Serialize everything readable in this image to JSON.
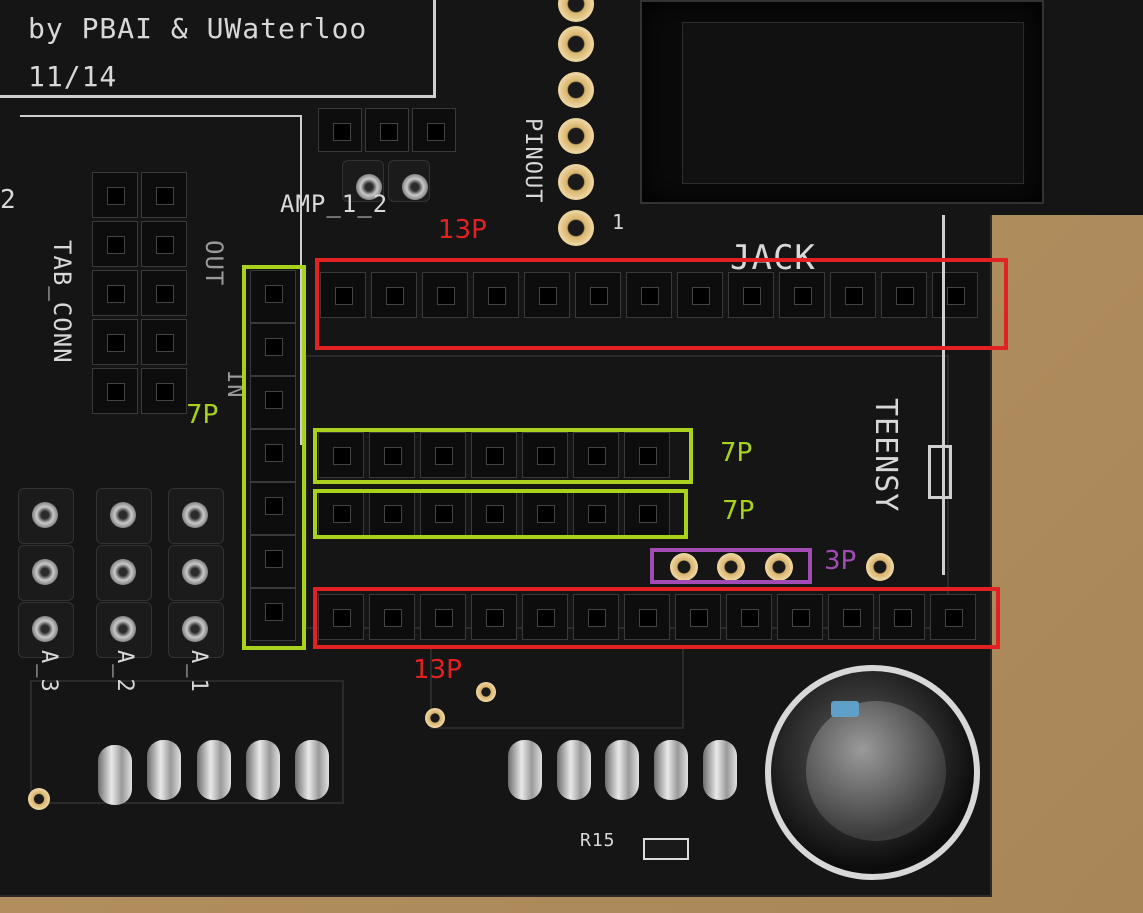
{
  "photo": {
    "board_silkscreen": {
      "credit": "by PBAI & UWaterloo",
      "date": "11/14",
      "amp_label": "AMP_1_2",
      "pinout_label": "PINOUT",
      "jack_label": "JACK",
      "teensy_label": "TEENSY",
      "tab_conn_label": "TAB_CONN",
      "out_label": "OUT",
      "in_label": "IN",
      "a3_label": "A_3",
      "a2_label": "A_2",
      "a1_label": "A_1",
      "r15_label": "R15",
      "pin1_label": "1",
      "num2_label": "2"
    },
    "annotations": {
      "top_13p": "13P",
      "bottom_13p": "13P",
      "vertical_7p": "7P",
      "row1_7p": "7P",
      "row2_7p": "7P",
      "pads_3p": "3P"
    },
    "colors": {
      "red_box": "#e22222",
      "green_box": "#a8d21e",
      "purple_box": "#a34bb5",
      "pcb": "#151515",
      "table": "#b89766"
    }
  }
}
